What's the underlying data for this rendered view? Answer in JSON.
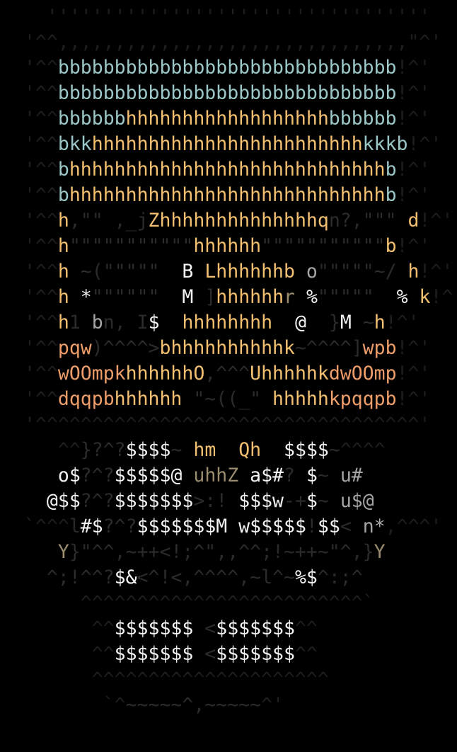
{
  "palette": {
    "D": "#1e1e1e",
    "M": "#2b2b2b",
    "G": "#3d3d3d",
    "t": "#9cc7c8",
    "o": "#f2c070",
    "s": "#ee9e6a",
    "k": "#9a8c6e",
    "w": "#f4f4f4",
    "g": "#a6a6a6",
    "n": "#6e6e6e"
  },
  "rows": [
    [
      [
        "D",
        "  '''''''''''''''''''''''''''''''''' "
      ]
    ],
    [
      [
        "D",
        "'^^,,,,,,,,,,,,,,,,,,,,,,,,,,,,,,,\"^'"
      ]
    ],
    [
      [
        "D",
        "'^^"
      ],
      [
        "t",
        "bbbbbbbbbbbbbbbbbbbbbbbbbbbbbb"
      ],
      [
        "D",
        "!^'"
      ]
    ],
    [
      [
        "D",
        "'^^"
      ],
      [
        "t",
        "bbbbbbbbbbbbbbbbbbbbbbbbbbbbbb"
      ],
      [
        "D",
        "!^'"
      ]
    ],
    [
      [
        "D",
        "'^^"
      ],
      [
        "t",
        "bbbbbb"
      ],
      [
        "o",
        "hhhhhhhhhhhhhhhhhh"
      ],
      [
        "t",
        "bbbbbb"
      ],
      [
        "D",
        "!^'"
      ]
    ],
    [
      [
        "D",
        "'^^"
      ],
      [
        "t",
        "bkk"
      ],
      [
        "o",
        "hhhhhhhhhhhhhhhhhhhhhhhh"
      ],
      [
        "t",
        "kkkb"
      ],
      [
        "D",
        "!^'"
      ]
    ],
    [
      [
        "D",
        "'^^"
      ],
      [
        "t",
        "b"
      ],
      [
        "o",
        "hhhhhhhhhhhhhhhhhhhhhhhhhhhh"
      ],
      [
        "t",
        "b"
      ],
      [
        "D",
        "!^'"
      ]
    ],
    [
      [
        "D",
        "'^^"
      ],
      [
        "t",
        "b"
      ],
      [
        "o",
        "hhhhhhhhhhhhhhhhhhhhhhhhhhhh"
      ],
      [
        "t",
        "b"
      ],
      [
        "D",
        "!^'"
      ]
    ],
    [
      [
        "D",
        "'^^"
      ],
      [
        "o",
        "h"
      ],
      [
        "M",
        ",\"\" ,_j"
      ],
      [
        "o",
        "Zhhhhhhhhhhhhhhq"
      ],
      [
        "M",
        "n?,\"\"\" "
      ],
      [
        "o",
        "d"
      ],
      [
        "D",
        "!^'"
      ]
    ],
    [
      [
        "D",
        "'^^"
      ],
      [
        "o",
        "h"
      ],
      [
        "M",
        "\"\"\"\"\"\"\"\"\"\"\""
      ],
      [
        "o",
        "hhhhhh"
      ],
      [
        "M",
        "\"\"\"\"\"\"\"\"\"\"\""
      ],
      [
        "o",
        "b"
      ],
      [
        "D",
        "!^'"
      ]
    ],
    [
      [
        "D",
        "'^^"
      ],
      [
        "o",
        "h"
      ],
      [
        "M",
        " ~(\"\"\"\"\"  "
      ],
      [
        "w",
        "B "
      ],
      [
        "o",
        "Lhhhhhhb"
      ],
      [
        "g",
        " o"
      ],
      [
        "M",
        "\"\"\"\"\"~/ "
      ],
      [
        "o",
        "h"
      ],
      [
        "D",
        "!^'"
      ]
    ],
    [
      [
        "D",
        "'^^"
      ],
      [
        "o",
        "h"
      ],
      [
        "w",
        " *"
      ],
      [
        "M",
        "\"\"\"\"\"\"  "
      ],
      [
        "w",
        "M "
      ],
      [
        "M",
        "]"
      ],
      [
        "o",
        "hhhhhh"
      ],
      [
        "k",
        "r"
      ],
      [
        "w",
        " %"
      ],
      [
        "M",
        "\"\"\"\"\"  "
      ],
      [
        "w",
        "% "
      ],
      [
        "o",
        "k"
      ],
      [
        "D",
        "!^'"
      ]
    ],
    [
      [
        "D",
        "'^^"
      ],
      [
        "o",
        "h"
      ],
      [
        "M",
        "1 "
      ],
      [
        "g",
        "b"
      ],
      [
        "M",
        "n, I"
      ],
      [
        "w",
        "$  "
      ],
      [
        "o",
        "hhhhhhhh"
      ],
      [
        "w",
        "  @"
      ],
      [
        "M",
        "  }"
      ],
      [
        "w",
        "M "
      ],
      [
        "M",
        "~"
      ],
      [
        "o",
        "h"
      ],
      [
        "D",
        "!^'"
      ]
    ],
    [
      [
        "D",
        "'^^"
      ],
      [
        "s",
        "pqw"
      ],
      [
        "M",
        ")^^^^>"
      ],
      [
        "o",
        "bhhhhhhhhhhk"
      ],
      [
        "M",
        "~^^^^]"
      ],
      [
        "s",
        "wpb"
      ],
      [
        "D",
        "!^'"
      ]
    ],
    [
      [
        "D",
        "'^^"
      ],
      [
        "s",
        "wOOmpk"
      ],
      [
        "o",
        "hhhhhhO"
      ],
      [
        "M",
        ",^^^"
      ],
      [
        "o",
        "Uhhhhhk"
      ],
      [
        "s",
        "dwOOmp"
      ],
      [
        "D",
        "!^'"
      ]
    ],
    [
      [
        "D",
        "'^^"
      ],
      [
        "s",
        "dqqpb"
      ],
      [
        "o",
        "hhhhhh "
      ],
      [
        "M",
        "\"~((_\" "
      ],
      [
        "o",
        "hhhhh"
      ],
      [
        "s",
        "kpqqpb"
      ],
      [
        "D",
        "!^'"
      ]
    ],
    [
      [
        "D",
        "'^^^^^^^^^^^^^^^^^^^^^^^^^^^^^^^^^^'"
      ]
    ],
    [
      [
        "D",
        "   ^^"
      ],
      [
        "M",
        "}?^?"
      ],
      [
        "w",
        "$$$$"
      ],
      [
        "M",
        "~ "
      ],
      [
        "o",
        "hm"
      ],
      [
        "M",
        "  "
      ],
      [
        "o",
        "Qh"
      ],
      [
        "M",
        "  "
      ],
      [
        "w",
        "$$$$"
      ],
      [
        "M",
        "~"
      ],
      [
        "D",
        "^^^^"
      ]
    ],
    [
      [
        "D",
        "  "
      ],
      [
        "w",
        " o$"
      ],
      [
        "M",
        "?^?"
      ],
      [
        "w",
        "$$$$$@"
      ],
      [
        "k",
        " uhhZ"
      ],
      [
        "w",
        " a$#"
      ],
      [
        "M",
        "? "
      ],
      [
        "w",
        "$"
      ],
      [
        "M",
        "~ "
      ],
      [
        "g",
        "u#"
      ]
    ],
    [
      [
        "D",
        "  "
      ],
      [
        "w",
        "@$$"
      ],
      [
        "M",
        "?^?"
      ],
      [
        "w",
        "$$$$$$$"
      ],
      [
        "M",
        ">:!"
      ],
      [
        "w",
        " $$$w"
      ],
      [
        "M",
        "-+"
      ],
      [
        "w",
        "$"
      ],
      [
        "M",
        "~ "
      ],
      [
        "g",
        "u$@"
      ]
    ],
    [
      [
        "D",
        "`^^^"
      ],
      [
        "M",
        "l"
      ],
      [
        "w",
        "#$"
      ],
      [
        "M",
        "?^?"
      ],
      [
        "w",
        "$$$$$$$M w$$$$$"
      ],
      [
        "M",
        "!"
      ],
      [
        "w",
        "$$"
      ],
      [
        "M",
        "< "
      ],
      [
        "g",
        "n*"
      ],
      [
        "D",
        ",^^^'"
      ]
    ],
    [
      [
        "D",
        "  "
      ],
      [
        "k",
        " Y"
      ],
      [
        "M",
        "}\"^^,~++<!;^\",,^^;!~++~\"^,}"
      ],
      [
        "k",
        "Y"
      ]
    ],
    [
      [
        "D",
        "  "
      ],
      [
        "M",
        "^;!^^?"
      ],
      [
        "w",
        "$&"
      ],
      [
        "M",
        "<^!<,^^^^,~l^~"
      ],
      [
        "w",
        "%$"
      ],
      [
        "M",
        "^:;^"
      ]
    ],
    [
      [
        "D",
        "     ^^^^^^^^^^^^^^^^^^^^^^^^^`"
      ]
    ],
    [
      [
        "D",
        "      ^^"
      ],
      [
        "w",
        "$$$$$$$"
      ],
      [
        "M",
        " <"
      ],
      [
        "w",
        "$$$$$$$"
      ],
      [
        "D",
        "^^"
      ]
    ],
    [
      [
        "D",
        "      ^^"
      ],
      [
        "w",
        "$$$$$$$"
      ],
      [
        "M",
        " <"
      ],
      [
        "w",
        "$$$$$$$"
      ],
      [
        "D",
        "^^"
      ]
    ],
    [
      [
        "D",
        "      ^^^^^^^^^^^^^^^^^^^^^"
      ]
    ],
    [
      [
        "D",
        "       `^"
      ],
      [
        "M",
        "~~~~~^,~~~~~"
      ],
      [
        "D",
        "^'"
      ]
    ]
  ]
}
